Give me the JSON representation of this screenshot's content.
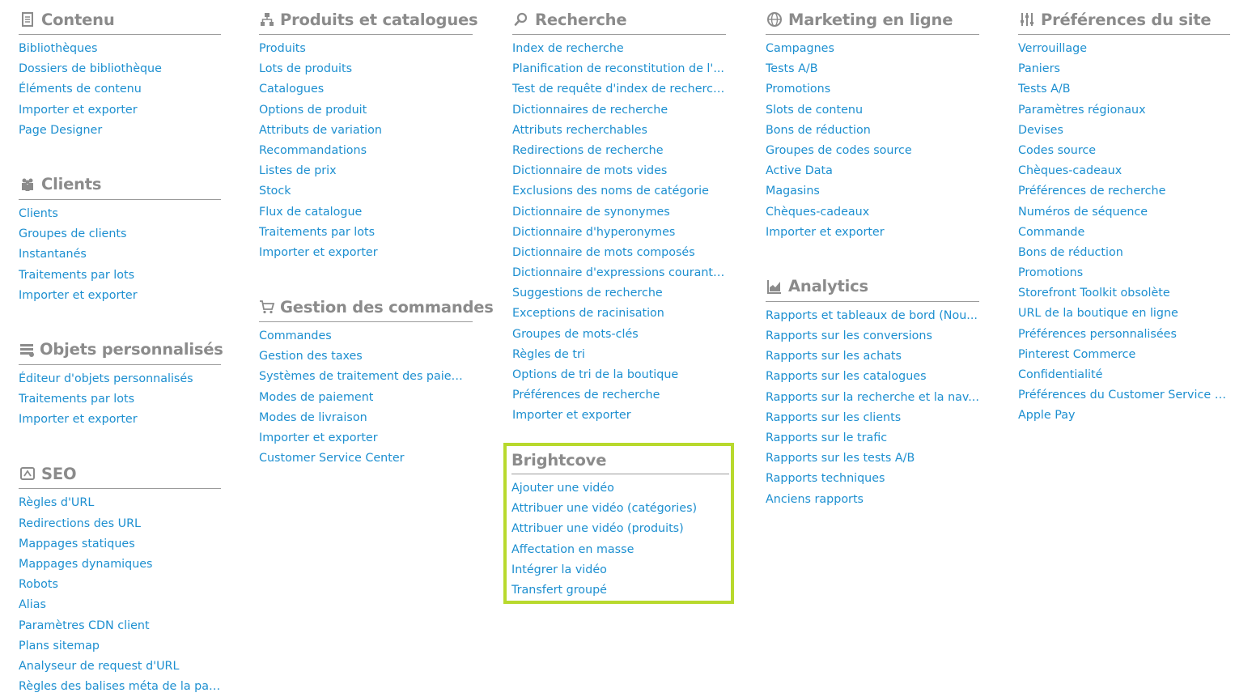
{
  "columns": [
    {
      "sections": [
        {
          "id": "contenu",
          "icon": "document-icon",
          "title": "Contenu",
          "links": [
            "Bibliothèques",
            "Dossiers de bibliothèque",
            "Éléments de contenu",
            "Importer et exporter",
            "Page Designer"
          ]
        },
        {
          "id": "clients",
          "icon": "users-icon",
          "title": "Clients",
          "links": [
            "Clients",
            "Groupes de clients",
            "Instantanés",
            "Traitements par lots",
            "Importer et exporter"
          ]
        },
        {
          "id": "objets-personnalises",
          "icon": "stack-icon",
          "title": "Objets personnalisés",
          "links": [
            "Éditeur d'objets personnalisés",
            "Traitements par lots",
            "Importer et exporter"
          ]
        },
        {
          "id": "seo",
          "icon": "seo-icon",
          "title": "SEO",
          "links": [
            "Règles d'URL",
            "Redirections des URL",
            "Mappages statiques",
            "Mappages dynamiques",
            "Robots",
            "Alias",
            "Paramètres CDN client",
            "Plans sitemap",
            "Analyseur de request d'URL",
            "Règles des balises méta de la page"
          ]
        }
      ]
    },
    {
      "sections": [
        {
          "id": "produits-catalogues",
          "icon": "hierarchy-icon",
          "title": "Produits et catalogues",
          "links": [
            "Produits",
            "Lots de produits",
            "Catalogues",
            "Options de produit",
            "Attributs de variation",
            "Recommandations",
            "Listes de prix",
            "Stock",
            "Flux de catalogue",
            "Traitements par lots",
            "Importer et exporter"
          ]
        },
        {
          "id": "gestion-commandes",
          "icon": "cart-icon",
          "title": "Gestion des commandes",
          "links": [
            "Commandes",
            "Gestion des taxes",
            "Systèmes de traitement des paiem...",
            "Modes de paiement",
            "Modes de livraison",
            "Importer et exporter",
            "Customer Service Center"
          ]
        }
      ]
    },
    {
      "sections": [
        {
          "id": "recherche",
          "icon": "search-icon",
          "title": "Recherche",
          "links": [
            "Index de recherche",
            "Planification de reconstitution de l'...",
            "Test de requête d'index de recherche",
            "Dictionnaires de recherche",
            "Attributs recherchables",
            "Redirections de recherche",
            "Dictionnaire de mots vides",
            "Exclusions des noms de catégorie",
            "Dictionnaire de synonymes",
            "Dictionnaire d'hyperonymes",
            "Dictionnaire de mots composés",
            "Dictionnaire d'expressions courantes",
            "Suggestions de recherche",
            "Exceptions de racinisation",
            "Groupes de mots-clés",
            "Règles de tri",
            "Options de tri de la boutique",
            "Préférences de recherche",
            "Importer et exporter"
          ]
        }
      ]
    },
    {
      "sections": [
        {
          "id": "marketing",
          "icon": "globe-icon",
          "title": "Marketing en ligne",
          "links": [
            "Campagnes",
            "Tests A/B",
            "Promotions",
            "Slots de contenu",
            "Bons de réduction",
            "Groupes de codes source",
            "Active Data",
            "Magasins",
            "Chèques-cadeaux",
            "Importer et exporter"
          ]
        },
        {
          "id": "analytics",
          "icon": "chart-icon",
          "title": "Analytics",
          "links": [
            "Rapports et tableaux de bord (Nou...",
            "Rapports sur les conversions",
            "Rapports sur les achats",
            "Rapports sur les catalogues",
            "Rapports sur la recherche et la nav...",
            "Rapports sur les clients",
            "Rapports sur le trafic",
            "Rapports sur les tests A/B",
            "Rapports techniques",
            "Anciens rapports"
          ]
        }
      ]
    },
    {
      "sections": [
        {
          "id": "preferences-site",
          "icon": "sliders-icon",
          "title": "Préférences du site",
          "links": [
            "Verrouillage",
            "Paniers",
            "Tests A/B",
            "Paramètres régionaux",
            "Devises",
            "Codes source",
            "Chèques-cadeaux",
            "Préférences de recherche",
            "Numéros de séquence",
            "Commande",
            "Bons de réduction",
            "Promotions",
            "Storefront Toolkit obsolète",
            "URL de la boutique en ligne",
            "Préférences personnalisées",
            "Pinterest Commerce",
            "Confidentialité",
            "Préférences du Customer Service C...",
            "Apple Pay"
          ]
        }
      ]
    }
  ],
  "brightcove": {
    "title": "Brightcove",
    "highlight_color": "#b8d92d",
    "links": [
      "Ajouter une vidéo",
      "Attribuer une vidéo (catégories)",
      "Attribuer une vidéo (produits)",
      "Affectation en masse",
      "Intégrer la vidéo",
      "Transfert groupé"
    ]
  },
  "colors": {
    "link": "#1d8fd0",
    "heading": "#8b8b8b",
    "rule": "#9a9a9a"
  }
}
